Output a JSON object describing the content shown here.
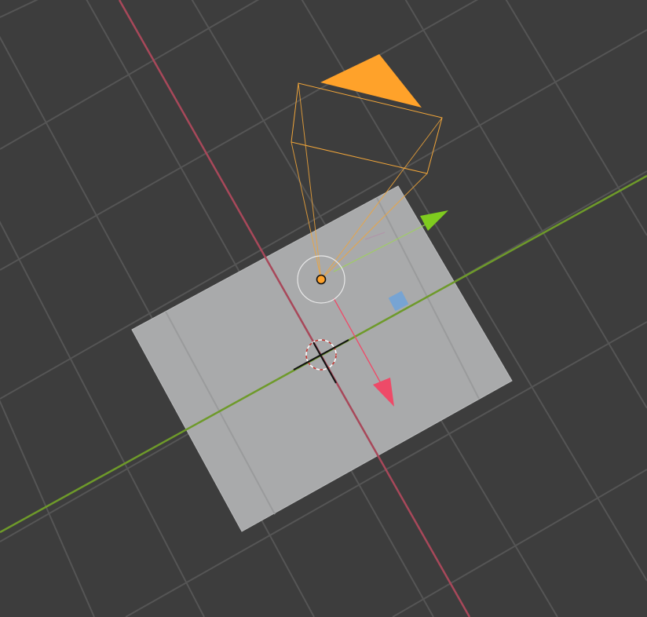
{
  "viewport": {
    "background": "#3d3d3d",
    "grid_color": "#555555"
  },
  "axes": {
    "x_color": "#a8485a",
    "y_color": "#6e9a2a"
  },
  "plane": {
    "face_color": "#a9aaab"
  },
  "camera": {
    "wire_color": "#f0a53a",
    "up_triangle_color": "#ffa22a",
    "origin_fill": "#ffa22a"
  },
  "gizmo": {
    "icon": "move-gizmo-icon",
    "x_arrow_color": "#ee4a68",
    "y_arrow_color": "#7fcb1f",
    "plane_handle_color": "#6fa3d9"
  },
  "cursor": {
    "icon": "3d-cursor-icon"
  }
}
